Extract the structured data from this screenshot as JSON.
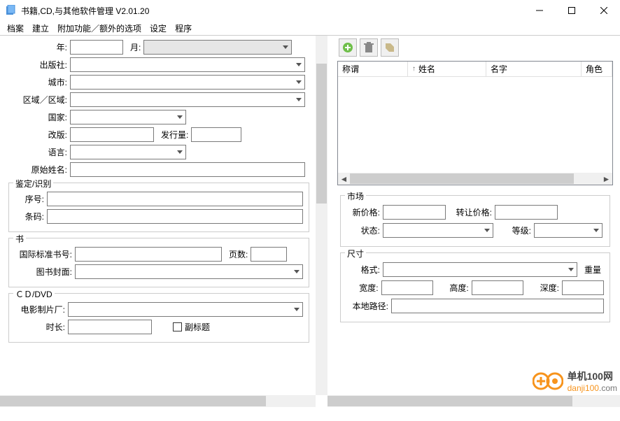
{
  "window": {
    "title": "书籍,CD,与其他软件管理 V2.01.20"
  },
  "menu": {
    "file": "档案",
    "create": "建立",
    "addon": "附加功能／额外的选项",
    "settings": "设定",
    "program": "程序"
  },
  "left": {
    "year": "年:",
    "month": "月:",
    "publisher": "出版社:",
    "city": "城市:",
    "region": "区域／区域:",
    "country": "国家:",
    "edition": "改版:",
    "circulation": "发行量:",
    "language": "语言:",
    "originalName": "原始姓名:",
    "ident": {
      "legend": "鉴定/识别",
      "serial": "序号:",
      "barcode": "条码:"
    },
    "book": {
      "legend": "书",
      "isbn": "国际标准书号:",
      "pages": "页数:",
      "cover": "图书封面:"
    },
    "cd": {
      "legend": "ＣＤ/DVD",
      "studio": "电影制片厂:",
      "duration": "时长:",
      "subtitle": "副标题"
    }
  },
  "right": {
    "grid": {
      "salutation": "称谓",
      "surname": "姓名",
      "firstname": "名字",
      "role": "角色"
    },
    "market": {
      "legend": "市场",
      "newPrice": "新价格:",
      "transferPrice": "转让价格:",
      "status": "状态:",
      "grade": "等级:"
    },
    "size": {
      "legend": "尺寸",
      "format": "格式:",
      "weight": "重量",
      "width": "宽度:",
      "height": "高度:",
      "depth": "深度:",
      "localPath": "本地路径:"
    }
  },
  "logo": {
    "line1": "单机100网",
    "line2a": "danji100",
    "line2b": "com"
  }
}
